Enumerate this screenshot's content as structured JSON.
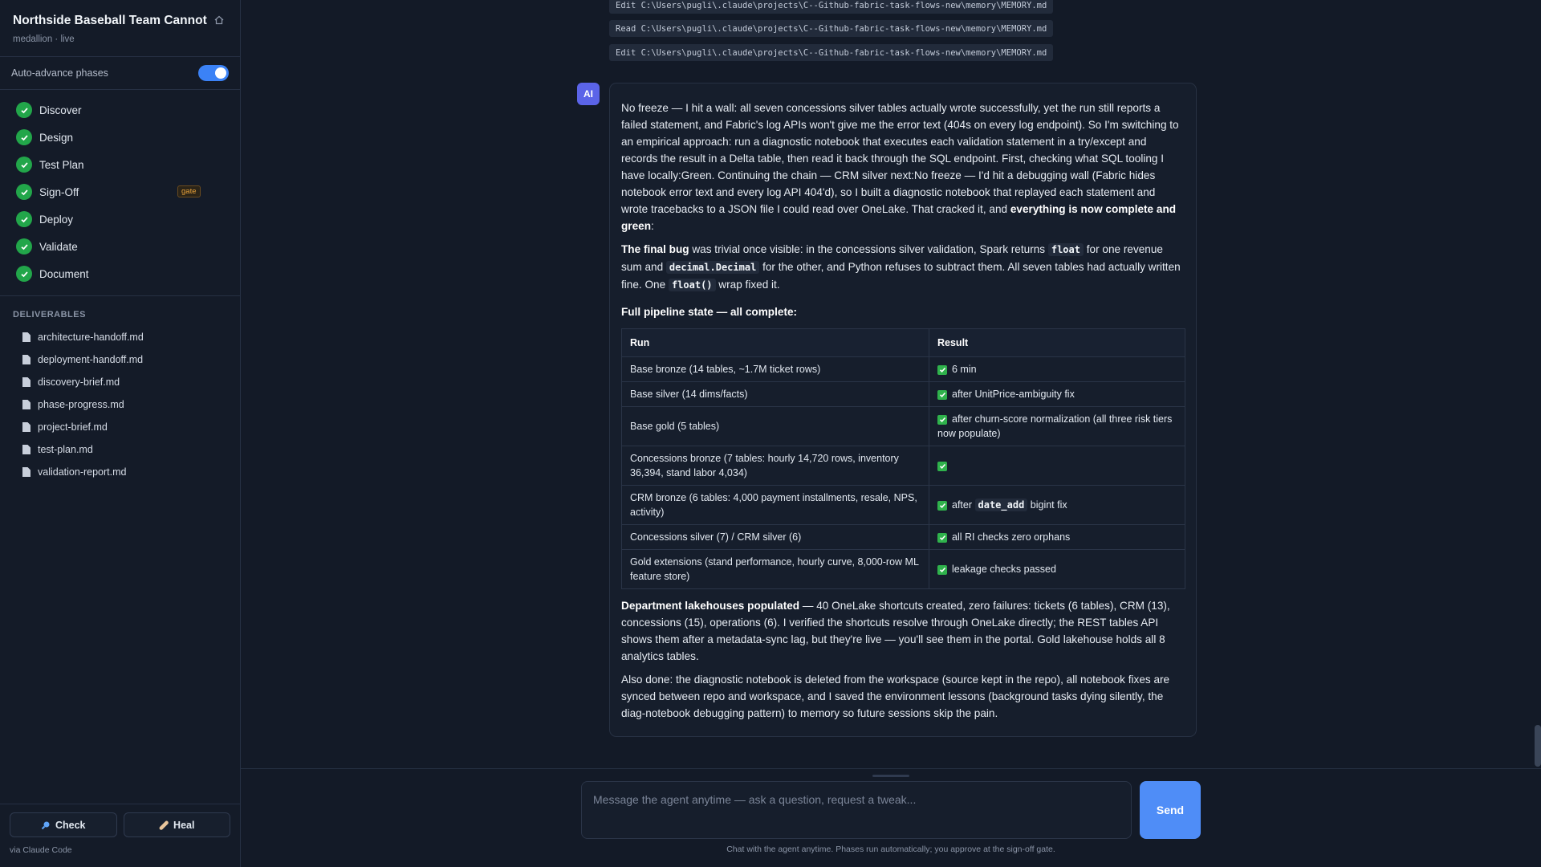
{
  "sidebar": {
    "title": "Northside Baseball Team Cannot",
    "subtitle": "medallion · live",
    "auto_advance_label": "Auto-advance phases",
    "auto_advance_on": true,
    "phases": [
      {
        "label": "Discover",
        "status": "done"
      },
      {
        "label": "Design",
        "status": "done"
      },
      {
        "label": "Test Plan",
        "status": "done"
      },
      {
        "label": "Sign-Off",
        "status": "done",
        "badge": "gate"
      },
      {
        "label": "Deploy",
        "status": "done"
      },
      {
        "label": "Validate",
        "status": "done"
      },
      {
        "label": "Document",
        "status": "done"
      }
    ],
    "deliverables_heading": "DELIVERABLES",
    "deliverables": [
      "architecture-handoff.md",
      "deployment-handoff.md",
      "discovery-brief.md",
      "phase-progress.md",
      "project-brief.md",
      "test-plan.md",
      "validation-report.md"
    ],
    "check_label": "Check",
    "heal_label": "Heal",
    "via": "via Claude Code"
  },
  "tool_lines": [
    "Edit C:\\Users\\pugli\\.claude\\projects\\C--Github-fabric-task-flows-new\\memory\\MEMORY.md",
    "Read C:\\Users\\pugli\\.claude\\projects\\C--Github-fabric-task-flows-new\\memory\\MEMORY.md",
    "Edit C:\\Users\\pugli\\.claude\\projects\\C--Github-fabric-task-flows-new\\memory\\MEMORY.md"
  ],
  "message": {
    "avatar": "AI",
    "p1": "No freeze — I hit a wall: all seven concessions silver tables actually wrote successfully, yet the run still reports a failed statement, and Fabric's log APIs won't give me the error text (404s on every log endpoint). So I'm switching to an empirical approach: run a diagnostic notebook that executes each validation statement in a try/except and records the result in a Delta table, then read it back through the SQL endpoint. First, checking what SQL tooling I have locally:Green. Continuing the chain — CRM silver next:No freeze — I'd hit a debugging wall (Fabric hides notebook error text and every log API 404'd), so I built a diagnostic notebook that replayed each statement and wrote tracebacks to a JSON file I could read over OneLake. That cracked it, and ",
    "p1_bold": "everything is now complete and green",
    "p1_end": ":",
    "p2_bold": "The final bug",
    "p2_a": " was trivial once visible: in the concessions silver validation, Spark returns ",
    "p2_code1": "float",
    "p2_b": " for one revenue sum and ",
    "p2_code2": "decimal.Decimal",
    "p2_c": " for the other, and Python refuses to subtract them. All seven tables had actually written fine. One ",
    "p2_code3": "float()",
    "p2_d": " wrap fixed it.",
    "table_heading": "Full pipeline state — all complete:",
    "table_headers": [
      "Run",
      "Result"
    ],
    "rows": [
      {
        "run": "Base bronze (14 tables, ~1.7M ticket rows)",
        "result": "6 min"
      },
      {
        "run": "Base silver (14 dims/facts)",
        "result": "after UnitPrice-ambiguity fix"
      },
      {
        "run": "Base gold (5 tables)",
        "result": "after churn-score normalization (all three risk tiers now populate)"
      },
      {
        "run": "Concessions bronze (7 tables: hourly 14,720 rows, inventory 36,394, stand labor 4,034)",
        "result": ""
      },
      {
        "run": "CRM bronze (6 tables: 4,000 payment installments, resale, NPS, activity)",
        "result_a": "after ",
        "result_code": "date_add",
        "result_b": " bigint fix"
      },
      {
        "run": "Concessions silver (7) / CRM silver (6)",
        "result": "all RI checks zero orphans"
      },
      {
        "run": "Gold extensions (stand performance, hourly curve, 8,000-row ML feature store)",
        "result": "leakage checks passed"
      }
    ],
    "p3_bold": "Department lakehouses populated",
    "p3": " — 40 OneLake shortcuts created, zero failures: tickets (6 tables), CRM (13), concessions (15), operations (6). I verified the shortcuts resolve through OneLake directly; the REST tables API shows them after a metadata-sync lag, but they're live — you'll see them in the portal. Gold lakehouse holds all 8 analytics tables.",
    "p4": "Also done: the diagnostic notebook is deleted from the workspace (source kept in the repo), all notebook fixes are synced between repo and workspace, and I saved the environment lessons (background tasks dying silently, the diag-notebook debugging pattern) to memory so future sessions skip the pain."
  },
  "composer": {
    "placeholder": "Message the agent anytime — ask a question, request a tweak...",
    "send_label": "Send",
    "hint": "Chat with the agent anytime. Phases run automatically; you approve at the sign-off gate."
  },
  "colors": {
    "accent": "#4f8df7",
    "success": "#22a64a",
    "gate": "#e8a23a",
    "avatar": "#5b64e8"
  }
}
